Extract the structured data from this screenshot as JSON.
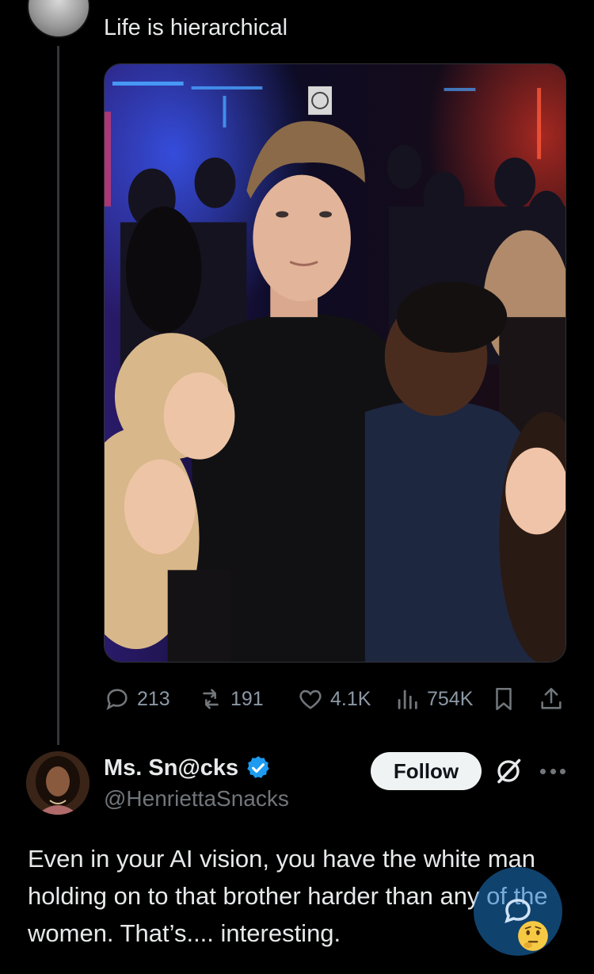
{
  "tweet1": {
    "text": "Life is hierarchical"
  },
  "tweet1_actions": {
    "replies": "213",
    "reposts": "191",
    "likes": "4.1K",
    "views": "754K"
  },
  "reply": {
    "display_name": "Ms. Sn@cks",
    "handle": "@HenriettaSnacks",
    "follow_label": "Follow",
    "text": "Even in your AI vision, you have the white man holding on to that brother harder than any of the women. That’s.... interesting. "
  },
  "icons": {
    "reply": "reply-icon",
    "repost": "repost-icon",
    "like": "heart-icon",
    "views": "views-icon",
    "bookmark": "bookmark-icon",
    "share": "share-icon",
    "verified": "verified-badge-icon",
    "grok": "grok-icon",
    "more": "more-icon",
    "compose": "compose-icon",
    "emoji": "thinking-face-emoji"
  },
  "colors": {
    "background": "#000000",
    "text": "#e7e9ea",
    "muted": "#71767b",
    "verified": "#1d9bf0",
    "follow_bg": "#eff3f4"
  }
}
